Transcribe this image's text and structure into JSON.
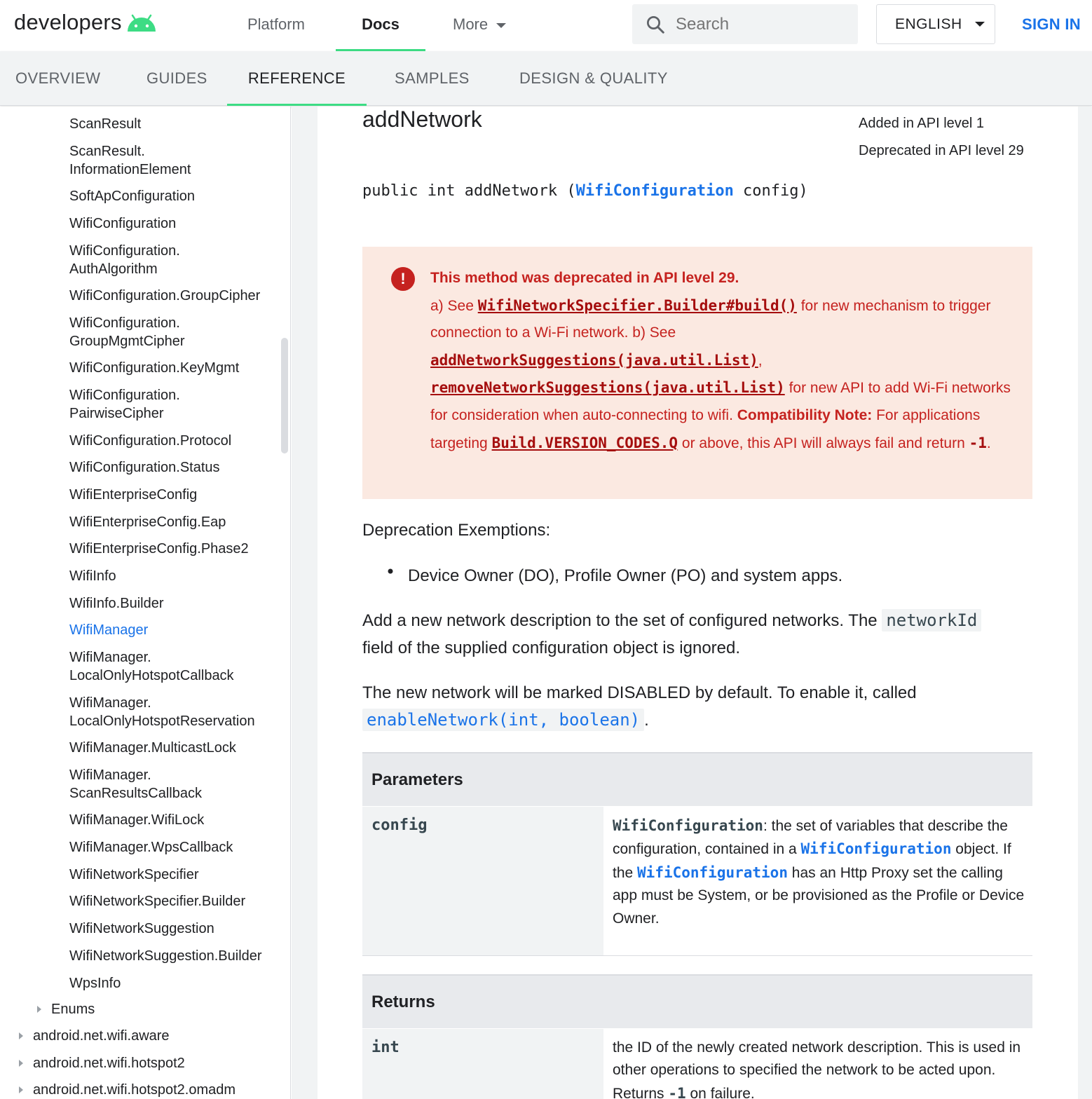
{
  "header": {
    "logo_text": "developers",
    "nav": [
      "Platform",
      "Docs",
      "More"
    ],
    "search_placeholder": "Search",
    "language": "ENGLISH",
    "sign_in": "SIGN IN"
  },
  "tabs": [
    "OVERVIEW",
    "GUIDES",
    "REFERENCE",
    "SAMPLES",
    "DESIGN & QUALITY"
  ],
  "sidebar": {
    "items": [
      [
        "ScanResult"
      ],
      [
        "ScanResult.",
        "InformationElement"
      ],
      [
        "SoftApConfiguration"
      ],
      [
        "WifiConfiguration"
      ],
      [
        "WifiConfiguration.",
        "AuthAlgorithm"
      ],
      [
        "WifiConfiguration.GroupCipher"
      ],
      [
        "WifiConfiguration.",
        "GroupMgmtCipher"
      ],
      [
        "WifiConfiguration.KeyMgmt"
      ],
      [
        "WifiConfiguration.",
        "PairwiseCipher"
      ],
      [
        "WifiConfiguration.Protocol"
      ],
      [
        "WifiConfiguration.Status"
      ],
      [
        "WifiEnterpriseConfig"
      ],
      [
        "WifiEnterpriseConfig.Eap"
      ],
      [
        "WifiEnterpriseConfig.Phase2"
      ],
      [
        "WifiInfo"
      ],
      [
        "WifiInfo.Builder"
      ],
      [
        "WifiManager"
      ],
      [
        "WifiManager.",
        "LocalOnlyHotspotCallback"
      ],
      [
        "WifiManager.",
        "LocalOnlyHotspotReservation"
      ],
      [
        "WifiManager.MulticastLock"
      ],
      [
        "WifiManager.",
        "ScanResultsCallback"
      ],
      [
        "WifiManager.WifiLock"
      ],
      [
        "WifiManager.WpsCallback"
      ],
      [
        "WifiNetworkSpecifier"
      ],
      [
        "WifiNetworkSpecifier.Builder"
      ],
      [
        "WifiNetworkSuggestion"
      ],
      [
        "WifiNetworkSuggestion.Builder"
      ],
      [
        "WpsInfo"
      ]
    ],
    "enums": "Enums",
    "packages": [
      "android.net.wifi.aware",
      "android.net.wifi.hotspot2",
      "android.net.wifi.hotspot2.omadm"
    ]
  },
  "method": {
    "name": "addNetwork",
    "added": "Added in API level 1",
    "deprecated": "Deprecated in API level 29",
    "sig_prefix": "public int addNetwork (",
    "sig_type": "WifiConfiguration",
    "sig_suffix": " config)"
  },
  "warning": {
    "title": "This method was deprecated in API level 29.",
    "p1": "a) See ",
    "link1": "WifiNetworkSpecifier.Builder#build()",
    "p2": " for new mechanism to trigger connection to a Wi-Fi network. b) See ",
    "link2": "addNetworkSuggestions(java.util.List)",
    "p3": ", ",
    "link3": "removeNetworkSuggestions(java.util.List)",
    "p4": " for new API to add Wi-Fi networks for consideration when auto-connecting to wifi. ",
    "compat": "Compatibility Note:",
    "p5": " For applications targeting ",
    "link4": "Build.VERSION_CODES.Q",
    "p6": " or above, this API will always fail and return ",
    "code1": "-1",
    "p7": "."
  },
  "body": {
    "exemptions_title": "Deprecation Exemptions:",
    "exemption_item": "Device Owner (DO), Profile Owner (PO) and system apps.",
    "desc1_a": "Add a new network description to the set of configured networks. The ",
    "desc1_code": "networkId",
    "desc1_b": "field of the supplied configuration object is ignored.",
    "desc2_a": "The new network will be marked DISABLED by default. To enable it, called",
    "desc2_code": "enableNetwork(int, boolean)",
    "desc2_b": "."
  },
  "parameters": {
    "title": "Parameters",
    "name": "config",
    "d_type": "WifiConfiguration",
    "d1": ": the set of variables that describe the configuration, contained in a ",
    "d_link1": "WifiConfiguration",
    "d2": " object. If the ",
    "d_link2": "WifiConfiguration",
    "d3": " has an Http Proxy set the calling app must be System, or be provisioned as the Profile or Device Owner."
  },
  "returns": {
    "title": "Returns",
    "type": "int",
    "d1": "the ID of the newly created network description. This is used in other operations to specified the network to be acted upon. Returns ",
    "d_code": "-1",
    "d2": " on failure."
  },
  "colors": {
    "brand_green": "#3ddc84",
    "link_blue": "#1a73e8",
    "warning_red": "#c5221f",
    "warning_bg": "#fbe9e1"
  }
}
